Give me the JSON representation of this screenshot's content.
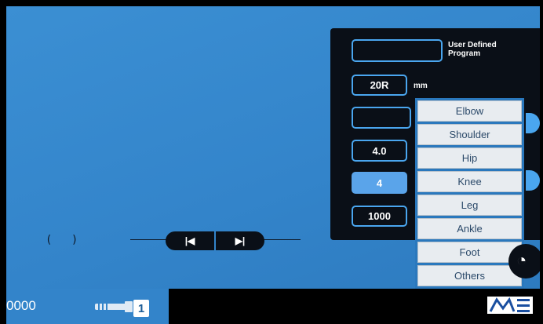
{
  "panel": {
    "program_label": "User Defined Program",
    "program_value": "",
    "diameter_value": "20R",
    "diameter_unit": "mm",
    "field3_value": "",
    "field4_value": "4.0",
    "field5_value": "4",
    "field6_value": "1000"
  },
  "dropdown": {
    "items": [
      "Elbow",
      "Shoulder",
      "Hip",
      "Knee",
      "Leg",
      "Ankle",
      "Foot",
      "Others"
    ]
  },
  "playback": {
    "brackets": "( )",
    "prev_glyph": "|◀",
    "next_glyph": "▶|"
  },
  "bottom": {
    "counter": "0000",
    "tool_number": "1",
    "logo_icon": "logo-icon"
  },
  "colors": {
    "screen_blue": "#3384ca",
    "panel_dark": "#0a0f17",
    "accent_blue": "#4aa6ef"
  }
}
